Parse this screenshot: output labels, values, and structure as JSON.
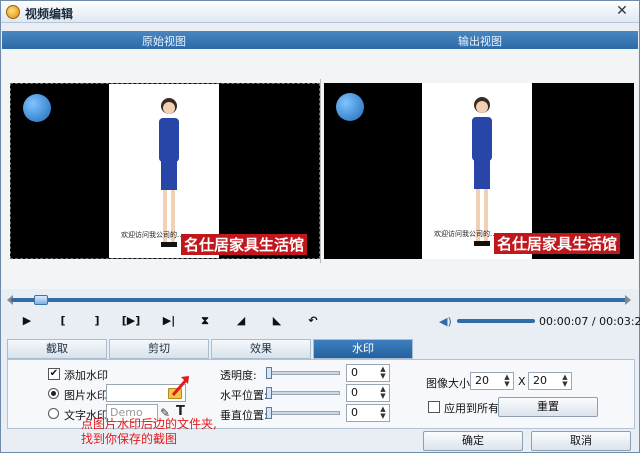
{
  "window": {
    "title": "视频编辑",
    "close": "✕"
  },
  "view": {
    "original_label": "原始视图",
    "output_label": "输出视图"
  },
  "video": {
    "watermark_text": "名仕居家具生活馆",
    "welcome_text": "欢迎访问我公司的...",
    "logo_text": "..."
  },
  "playback": {
    "time_current": "00:00:07",
    "time_separator": "/",
    "time_total": "00:03:25",
    "position_fraction": 0.035
  },
  "tabs": [
    {
      "label": "截取"
    },
    {
      "label": "剪切"
    },
    {
      "label": "效果"
    },
    {
      "label": "水印"
    }
  ],
  "watermark": {
    "add_watermark_label": "添加水印",
    "image_watermark_label": "图片水印:",
    "image_watermark_value": "",
    "text_watermark_label": "文字水印:",
    "text_watermark_placeholder": "Demo",
    "opacity_label": "透明度:",
    "opacity_value": "0",
    "h_position_label": "水平位置:",
    "h_position_value": "0",
    "v_position_label": "垂直位置:",
    "v_position_value": "0",
    "image_size_label": "图像大小:",
    "image_width": "20",
    "size_sep": "X",
    "image_height": "20",
    "apply_all_label": "应用到所有",
    "reset_button": "重置"
  },
  "footer": {
    "ok_button": "确定",
    "cancel_button": "取消"
  },
  "annotation": {
    "line1": "点图片水印后边的文件夹,",
    "line2": "找到你保存的截图"
  },
  "colors": {
    "accent": "#2c6aa8",
    "annotation": "#e11a1a",
    "watermark_bg": "#c0161c"
  }
}
